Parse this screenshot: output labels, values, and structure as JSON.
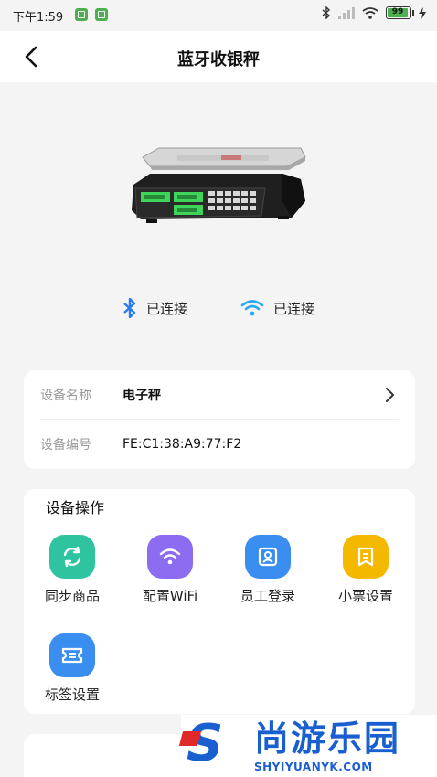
{
  "status_bar": {
    "time": "下午1:59",
    "battery_text": "99",
    "battery_level": 0.99,
    "icons": [
      "notification-app-icon",
      "notification-app-icon",
      "bluetooth-icon",
      "signal-icon",
      "wifi-icon",
      "battery-icon",
      "charging-icon"
    ]
  },
  "nav": {
    "title": "蓝牙收银秤",
    "back_icon": "chevron-left-icon"
  },
  "hero": {
    "image": "electronic-price-scale"
  },
  "connection": {
    "bluetooth_status": "已连接",
    "wifi_status": "已连接"
  },
  "device_info": {
    "name_label": "设备名称",
    "name_value": "电子秤",
    "id_label": "设备编号",
    "id_value": "FE:C1:38:A9:77:F2"
  },
  "operations": {
    "title": "设备操作",
    "items": [
      {
        "label": "同步商品",
        "icon": "sync-icon",
        "color": "#2ec4a0"
      },
      {
        "label": "配置WiFi",
        "icon": "wifi-icon",
        "color": "#8c6cf0"
      },
      {
        "label": "员工登录",
        "icon": "employee-badge-icon",
        "color": "#3a8ef0"
      },
      {
        "label": "小票设置",
        "icon": "receipt-icon",
        "color": "#f5b800"
      },
      {
        "label": "标签设置",
        "icon": "label-ticket-icon",
        "color": "#3a8ef0"
      }
    ]
  },
  "watermark": {
    "brand_letter": "S",
    "title": "尚游乐园",
    "subtitle": "SHYIYUANYK.COM"
  },
  "colors": {
    "background": "#f4f4f4",
    "bluetooth_blue": "#2b7cf0",
    "wifi_blue": "#2aa8f0",
    "watermark_blue": "#1a5fd0"
  }
}
